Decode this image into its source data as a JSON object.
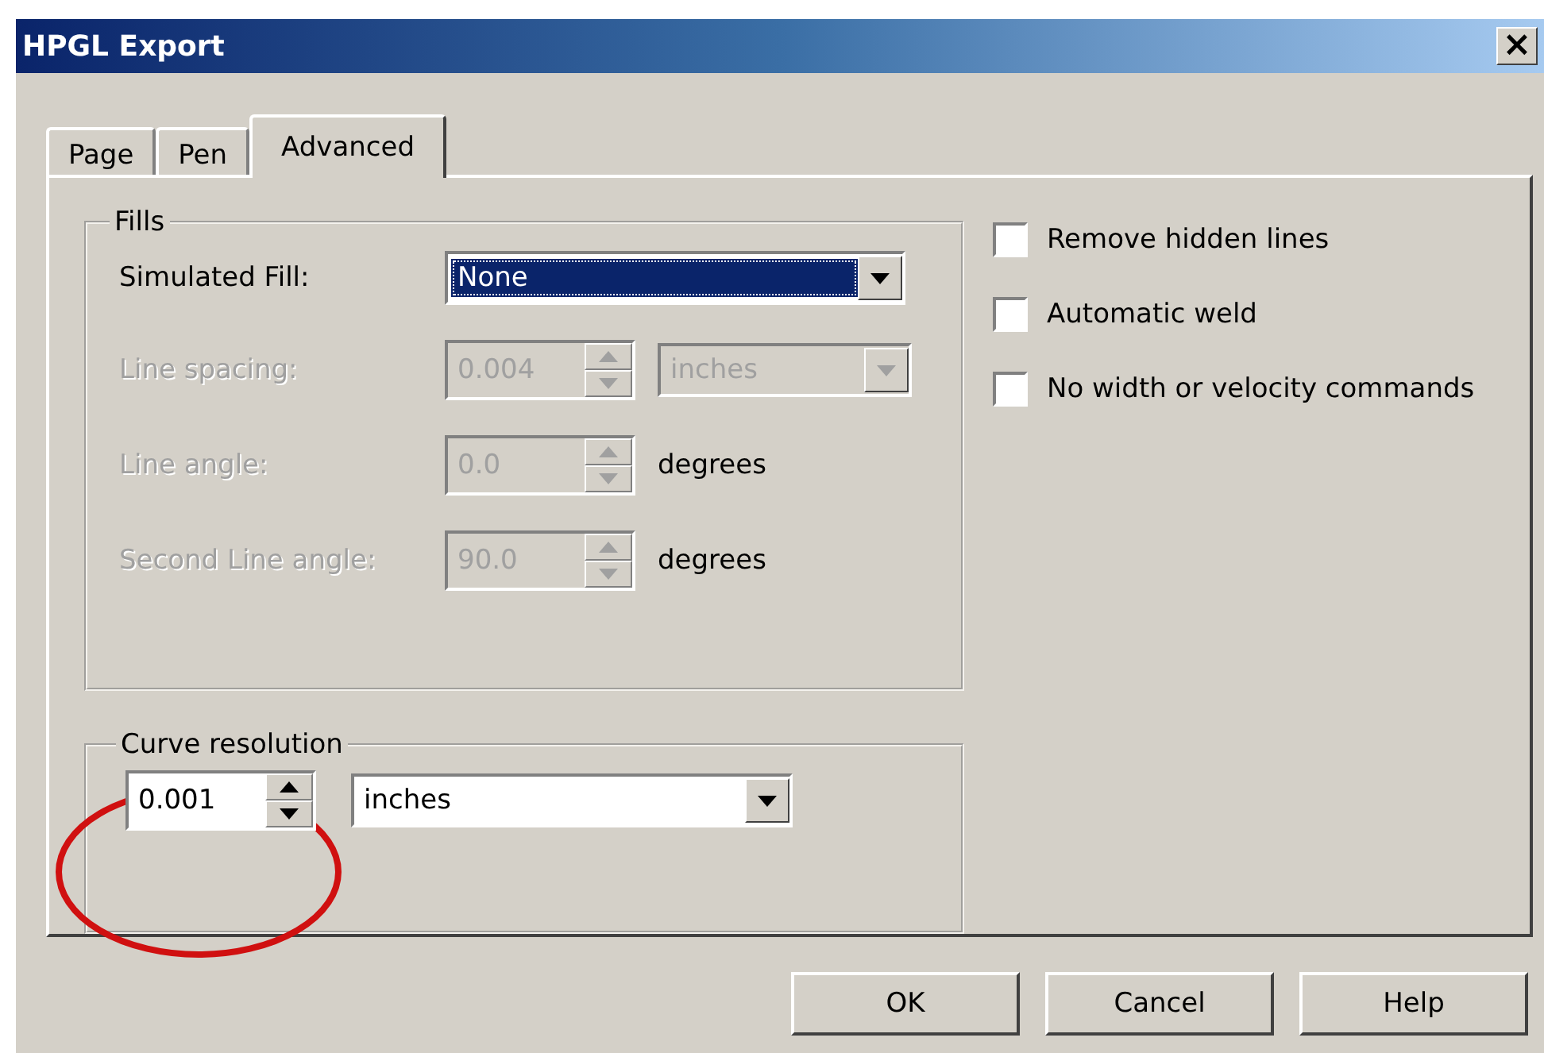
{
  "window": {
    "title": "HPGL Export",
    "close": "×"
  },
  "tabs": [
    {
      "label": "Page",
      "selected": false
    },
    {
      "label": "Pen",
      "selected": false
    },
    {
      "label": "Advanced",
      "selected": true
    }
  ],
  "fills": {
    "title": "Fills",
    "rows": [
      {
        "kind": "combo",
        "label": "Simulated Fill:",
        "value": "None",
        "disabled": false,
        "focused": true
      },
      {
        "kind": "spin_combo",
        "label": "Line spacing:",
        "value": "0.004",
        "unit": "inches",
        "disabled": true
      },
      {
        "kind": "spin_text",
        "label": "Line angle:",
        "value": "0.0",
        "unit": "degrees",
        "disabled": true
      },
      {
        "kind": "spin_text",
        "label": "Second Line angle:",
        "value": "90.0",
        "unit": "degrees",
        "disabled": true
      }
    ]
  },
  "options": [
    {
      "label": "Remove hidden lines",
      "checked": false
    },
    {
      "label": "Automatic weld",
      "checked": false
    },
    {
      "label": "No width or velocity commands",
      "checked": false
    }
  ],
  "curve_resolution": {
    "title": "Curve resolution",
    "value": "0.001",
    "unit": "inches"
  },
  "annotation": {
    "kind": "ellipse"
  },
  "buttons": [
    {
      "label": "OK"
    },
    {
      "label": "Cancel"
    },
    {
      "label": "Help"
    }
  ]
}
